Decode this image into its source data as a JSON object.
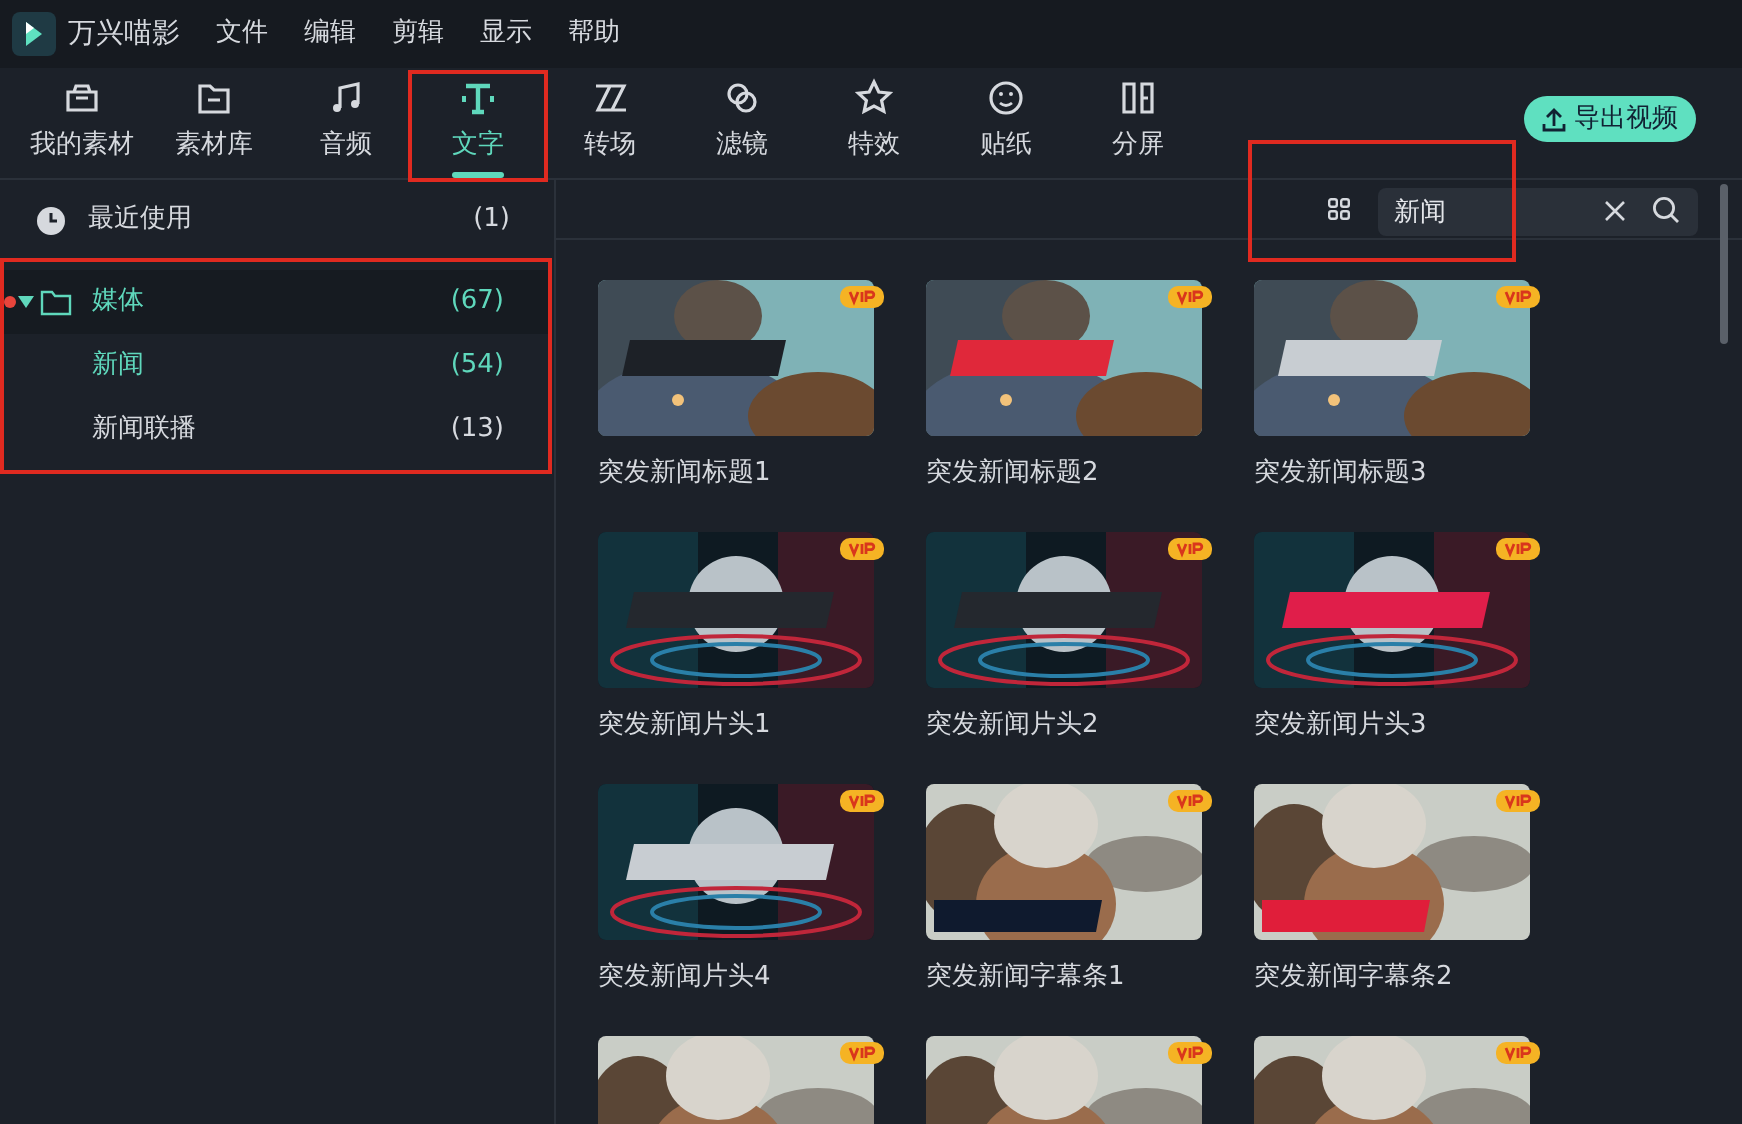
{
  "app": {
    "name": "万兴喵影"
  },
  "menu": [
    "文件",
    "编辑",
    "剪辑",
    "显示",
    "帮助"
  ],
  "tabs": [
    {
      "label": "我的素材",
      "selected": false,
      "highlighted": false
    },
    {
      "label": "素材库",
      "selected": false,
      "highlighted": false
    },
    {
      "label": "音频",
      "selected": false,
      "highlighted": false
    },
    {
      "label": "文字",
      "selected": true,
      "highlighted": true
    },
    {
      "label": "转场",
      "selected": false,
      "highlighted": false
    },
    {
      "label": "滤镜",
      "selected": false,
      "highlighted": false
    },
    {
      "label": "特效",
      "selected": false,
      "highlighted": false
    },
    {
      "label": "贴纸",
      "selected": false,
      "highlighted": false
    },
    {
      "label": "分屏",
      "selected": false,
      "highlighted": false
    }
  ],
  "export_button": "导出视频",
  "sidebar": {
    "highlighted": true,
    "items": [
      {
        "label": "最近使用",
        "count": "(1)",
        "kind": "recent",
        "selected": false
      },
      {
        "label": "媒体",
        "count": "(67)",
        "kind": "folder",
        "selected": true,
        "expanded": true,
        "dot": true,
        "children": [
          {
            "label": "新闻",
            "count": "(54)",
            "selected": true
          },
          {
            "label": "新闻联播",
            "count": "(13)",
            "selected": false
          }
        ]
      }
    ]
  },
  "search": {
    "value": "新闻",
    "highlighted": true
  },
  "templates": [
    {
      "title": "突发新闻标题1",
      "vip": true
    },
    {
      "title": "突发新闻标题2",
      "vip": true
    },
    {
      "title": "突发新闻标题3",
      "vip": true
    },
    {
      "title": "突发新闻片头1",
      "vip": true
    },
    {
      "title": "突发新闻片头2",
      "vip": true
    },
    {
      "title": "突发新闻片头3",
      "vip": true
    },
    {
      "title": "突发新闻片头4",
      "vip": true
    },
    {
      "title": "突发新闻字幕条1",
      "vip": true
    },
    {
      "title": "突发新闻字幕条2",
      "vip": true
    },
    {
      "vip": true
    },
    {
      "vip": true
    },
    {
      "vip": true
    }
  ]
}
